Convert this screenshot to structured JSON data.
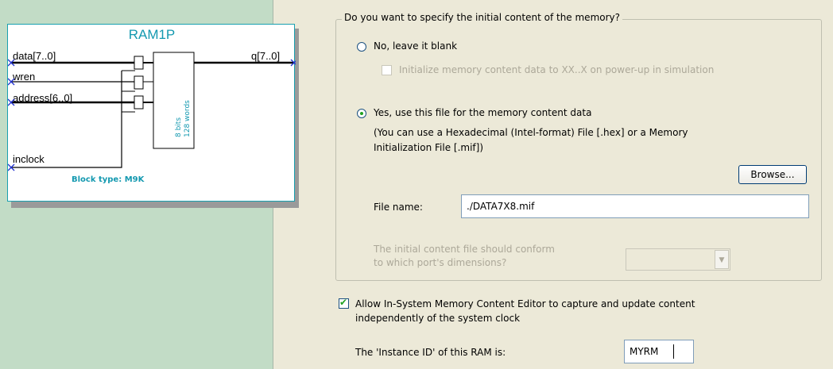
{
  "diagram": {
    "title": "RAM1P",
    "pins": {
      "data": "data[7..0]",
      "wren": "wren",
      "address": "address[6..0]",
      "inclock": "inclock",
      "q": "q[7..0]"
    },
    "memory_bits": "8 bits",
    "memory_words": "128 words",
    "block_type": "Block type: M9K",
    "colors": {
      "accent": "#1499b0",
      "pin_marker": "#2030d0",
      "panel": "#c2dcc6"
    }
  },
  "options": {
    "group_title": "Do you want to specify the initial content of the memory?",
    "radio_blank": "No, leave it blank",
    "check_initialize": "Initialize memory content data to XX..X on power-up in simulation",
    "radio_file": "Yes, use this file for the memory content data",
    "file_hint_1": "(You can use a Hexadecimal (Intel-format) File [.hex] or a Memory",
    "file_hint_2": "Initialization File [.mif])",
    "browse_label": "Browse...",
    "file_name_label": "File name:",
    "file_name_value": "./DATA7X8.mif",
    "conform_label_1": "The initial content file should conform",
    "conform_label_2": "to which port's dimensions?",
    "conform_value": "",
    "editor_check_1": "Allow In-System Memory Content Editor to capture and update content",
    "editor_check_2": "independently of the system clock",
    "instance_label": "The 'Instance ID' of this RAM is:",
    "instance_value": "MYRM"
  }
}
